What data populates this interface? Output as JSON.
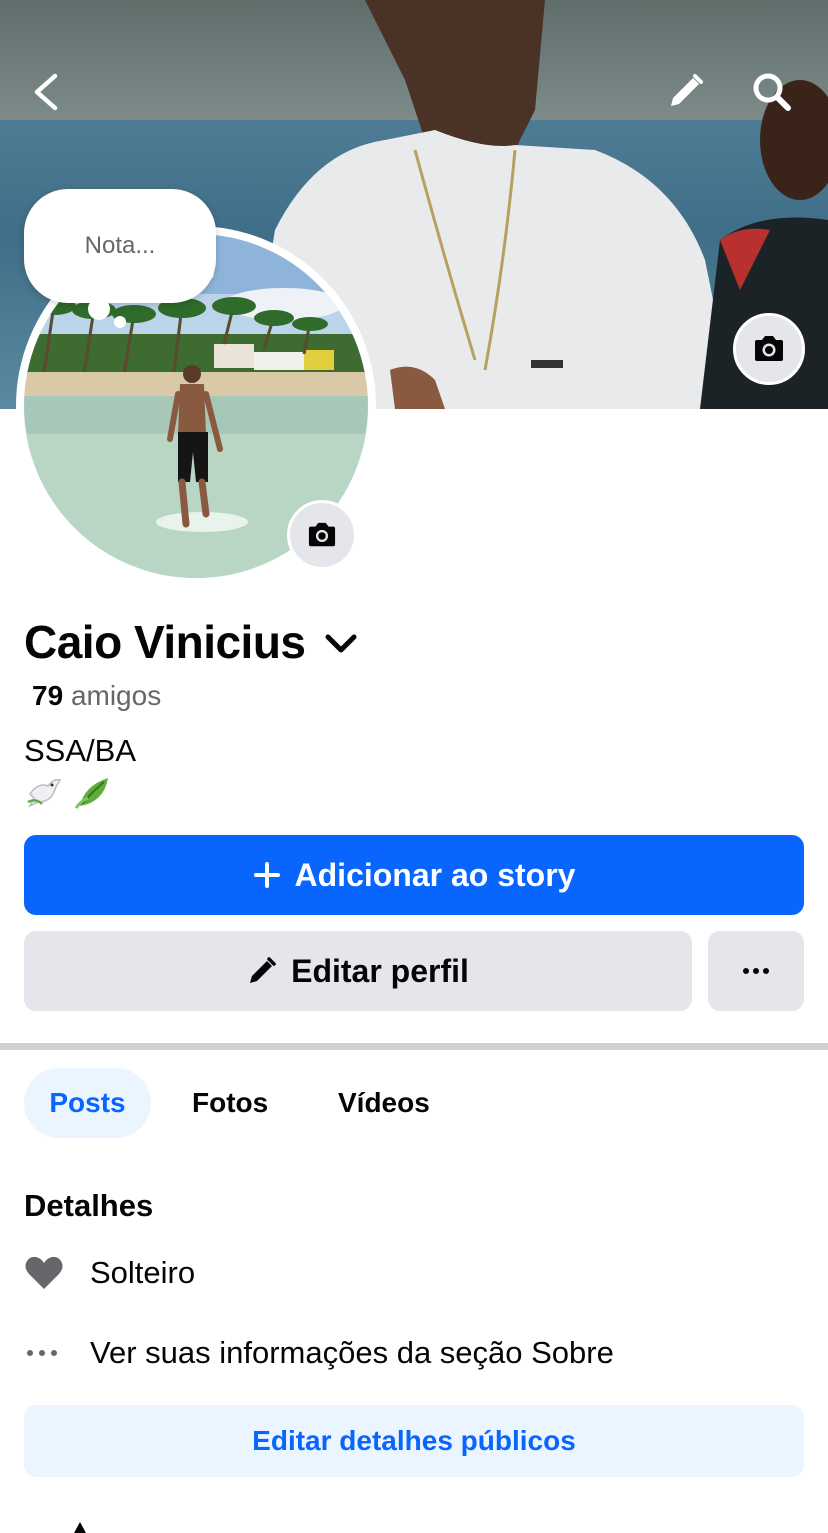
{
  "header": {
    "back_icon": "chevron-left-icon",
    "edit_icon": "pencil-icon",
    "search_icon": "search-icon"
  },
  "note": {
    "placeholder": "Nota..."
  },
  "profile": {
    "name": "Caio Vinicius",
    "friends_count": "79",
    "friends_label": "amigos",
    "bio_line1": "SSA/BA",
    "bio_emoji": [
      "🕊️",
      "🌿"
    ]
  },
  "actions": {
    "add_story": "Adicionar ao story",
    "edit_profile": "Editar perfil",
    "more": "..."
  },
  "tabs": [
    {
      "label": "Posts",
      "active": true
    },
    {
      "label": "Fotos",
      "active": false
    },
    {
      "label": "Vídeos",
      "active": false
    }
  ],
  "details": {
    "title": "Detalhes",
    "relationship": "Solteiro",
    "about_link": "Ver suas informações da seção Sobre",
    "edit_public": "Editar detalhes públicos"
  },
  "colors": {
    "primary": "#0866ff",
    "secondary_bg": "#e4e6eb",
    "tab_active_bg": "#ebf5ff",
    "muted_text": "#65676b"
  }
}
